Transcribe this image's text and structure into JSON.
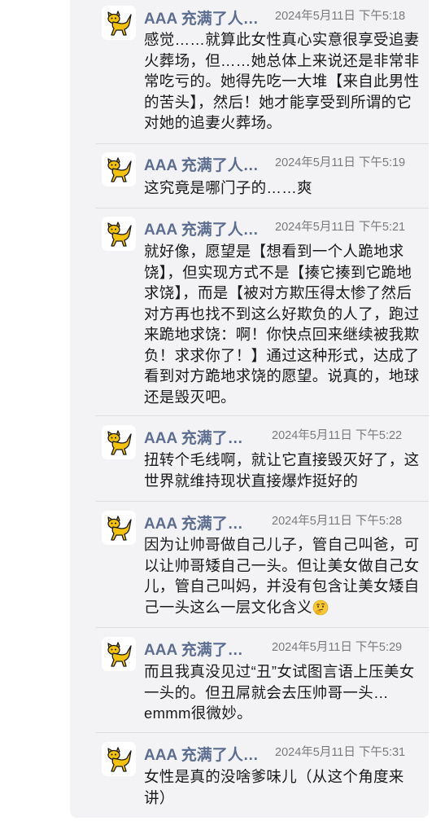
{
  "sender": "AAA 充满了人类…",
  "messages": [
    {
      "time": "2024年5月11日 下午5:18",
      "text": "感觉……就算此女性真心实意很享受追妻火葬场，但……她总体上来说还是非常非常吃亏的。她得先吃一大堆【来自此男性的苦头】，然后！她才能享受到所谓的它对她的追妻火葬场。"
    },
    {
      "time": "2024年5月11日 下午5:19",
      "text": "这究竟是哪门子的……爽"
    },
    {
      "time": "2024年5月11日 下午5:21",
      "text": "就好像，愿望是【想看到一个人跪地求饶】，但实现方式不是【揍它揍到它跪地求饶】，而是【被对方欺压得太惨了然后对方再也找不到这么好欺负的人了，跑过来跪地求饶：啊！你快点回来继续被我欺负！求求你了！】通过这种形式，达成了看到对方跪地求饶的愿望。说真的，地球还是毁灭吧。"
    },
    {
      "time": "2024年5月11日 下午5:22",
      "text": "扭转个毛线啊，就让它直接毁灭好了，这世界就维持现状直接爆炸挺好的"
    },
    {
      "time": "2024年5月11日 下午5:28",
      "text": "因为让帅哥做自己儿子，管自己叫爸，可以让帅哥矮自己一头。但让美女做自己女儿，管自己叫妈，并没有包含让美女矮自己一头这么一层文化含义",
      "emoji": "thinking-face-emoji"
    },
    {
      "time": "2024年5月11日 下午5:29",
      "text": "而且我真没见过“丑”女试图言语上压美女一头的。但丑屌就会去压帅哥一头…emmm很微妙。"
    },
    {
      "time": "2024年5月11日 下午5:31",
      "text": "女性是真的没啥爹味儿（从这个角度来讲）"
    }
  ],
  "icons": {
    "comment": "comment-bubble-icon",
    "avatar": "yellow-cat-avatar"
  },
  "colors": {
    "sender_name": "#5c6d8f",
    "thread_background": "#f3f3f6",
    "comment_icon": "#3b82f6"
  }
}
